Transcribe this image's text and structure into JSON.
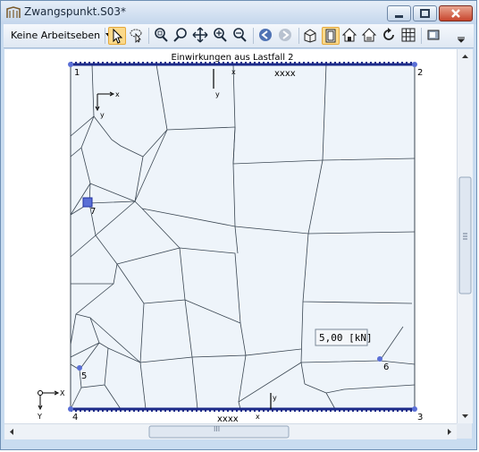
{
  "window": {
    "title": "Zwangspunkt.S03*"
  },
  "toolbar": {
    "workplane_label": "Keine Arbeitseben",
    "buttons": [
      {
        "name": "select-pointer-icon",
        "active": true
      },
      {
        "name": "lasso-select-icon",
        "active": false
      },
      {
        "name": "zoom-window-icon",
        "active": false
      },
      {
        "name": "zoom-magnify-icon",
        "active": false
      },
      {
        "name": "pan-move-icon",
        "active": false
      },
      {
        "name": "zoom-in-icon",
        "active": false
      },
      {
        "name": "zoom-out-icon",
        "active": false
      },
      {
        "name": "view-back-icon",
        "active": false
      },
      {
        "name": "view-forward-icon",
        "active": false
      },
      {
        "name": "iso-view-icon",
        "active": false
      },
      {
        "name": "front-view-icon",
        "active": true
      },
      {
        "name": "house-view-icon",
        "active": false
      },
      {
        "name": "house-view-2-icon",
        "active": false
      },
      {
        "name": "rotate-icon",
        "active": false
      },
      {
        "name": "grid-icon",
        "active": false
      },
      {
        "name": "render-icon",
        "active": false
      }
    ]
  },
  "canvas": {
    "heading": "Einwirkungen aus Lastfall 2",
    "corner_labels": [
      "1",
      "2",
      "3",
      "4"
    ],
    "node_labels": [
      "7",
      "5",
      "6"
    ],
    "edge_labels": {
      "top": "xxxx",
      "bottom": "xxxx"
    },
    "local_axes": {
      "x": "x",
      "y": "y"
    },
    "global_axes": {
      "x": "X",
      "y": "Y"
    },
    "load_value": "5,00 [kN]"
  },
  "scrollbar": {
    "h_grip": "III"
  },
  "colors": {
    "mesh_fill": "#eef4fa",
    "mesh_lines": "#3a4652",
    "support_hatch": "#1c2a88",
    "node": "#5a6fd6",
    "active_button": "#fbd98a"
  }
}
